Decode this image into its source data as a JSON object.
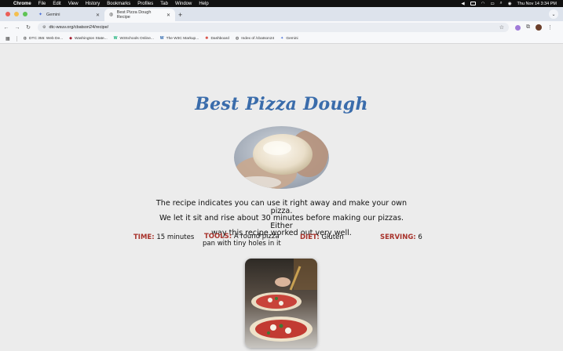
{
  "menubar": {
    "app": "Chrome",
    "items": [
      "File",
      "Edit",
      "View",
      "History",
      "Bookmarks",
      "Profiles",
      "Tab",
      "Window",
      "Help"
    ],
    "datetime": "Thu Nov 14  3:34 PM"
  },
  "tabs": [
    {
      "title": "Gemini",
      "icon": "gemini-icon",
      "active": false
    },
    {
      "title": "Best Pizza Dough Recipe",
      "icon": "globe-icon",
      "active": true
    }
  ],
  "toolbar": {
    "url": "dtc-wsuv.org/cbatson24/recipe/"
  },
  "bookmarks": [
    {
      "label": "DTC 355: Web De...",
      "icon": "globe-icon"
    },
    {
      "label": "Washington State...",
      "icon": "wsu-icon"
    },
    {
      "label": "W3Schools Online...",
      "icon": "w3schools-icon"
    },
    {
      "label": "The W3C Markup...",
      "icon": "w3c-icon"
    },
    {
      "label": "Dashboard",
      "icon": "canvas-icon"
    },
    {
      "label": "Index of /cbatson24",
      "icon": "globe-icon"
    },
    {
      "label": "Gemini",
      "icon": "gemini-icon"
    }
  ],
  "recipe": {
    "title": "Best Pizza Dough",
    "intro_lines": [
      "The recipe indicates you can use it right away and make your own pizza.",
      "We let it sit and rise about 30 minutes before making our pizzas. Either",
      "way this recipe worked out very well."
    ],
    "time_label": "TIME:",
    "time_value": "15 minutes",
    "tools_label": "TOOLS:",
    "tools_value_line1": "A round pizza",
    "tools_value_line2": "pan with tiny holes in it",
    "diet_label": "DIET:",
    "diet_value": "Gluten",
    "serving_label": "SERVING:",
    "serving_value": "6"
  },
  "colors": {
    "title": "#3a6cab",
    "fact_label": "#a8322b",
    "page_bg": "#ececec"
  }
}
